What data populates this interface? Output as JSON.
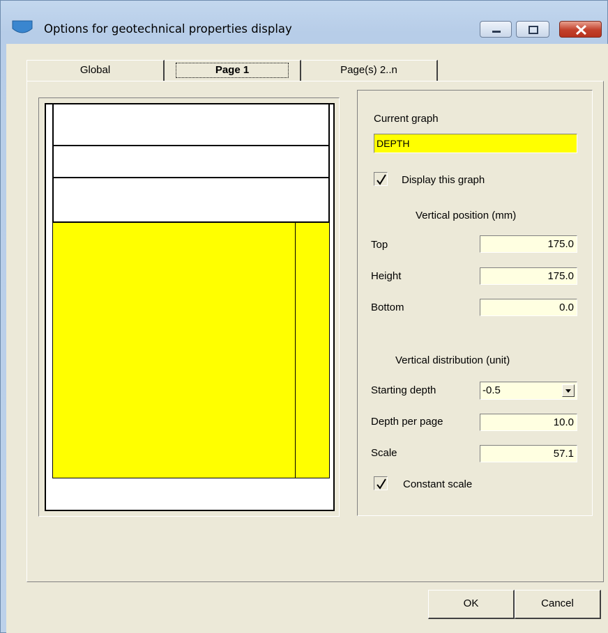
{
  "window": {
    "title": "Options for geotechnical properties display",
    "close_color": "#c2402b"
  },
  "tabs": [
    {
      "label": "Global",
      "selected": false
    },
    {
      "label": "Page 1",
      "selected": true
    },
    {
      "label": "Page(s) 2..n",
      "selected": false
    }
  ],
  "preview": {
    "graph_fill_color": "#ffff00"
  },
  "props": {
    "current_graph_label": "Current graph",
    "current_graph_value": "DEPTH",
    "display_graph_label": "Display this graph",
    "display_graph_checked": true,
    "vertical_position_heading": "Vertical position (mm)",
    "top_label": "Top",
    "top_value": "175.0",
    "height_label": "Height",
    "height_value": "175.0",
    "bottom_label": "Bottom",
    "bottom_value": "0.0",
    "vertical_distribution_heading": "Vertical distribution (unit)",
    "starting_depth_label": "Starting depth",
    "starting_depth_value": "-0.5",
    "depth_per_page_label": "Depth per page",
    "depth_per_page_value": "10.0",
    "scale_label": "Scale",
    "scale_value": "57.1",
    "constant_scale_label": "Constant scale",
    "constant_scale_checked": true
  },
  "buttons": {
    "ok": "OK",
    "cancel": "Cancel"
  }
}
